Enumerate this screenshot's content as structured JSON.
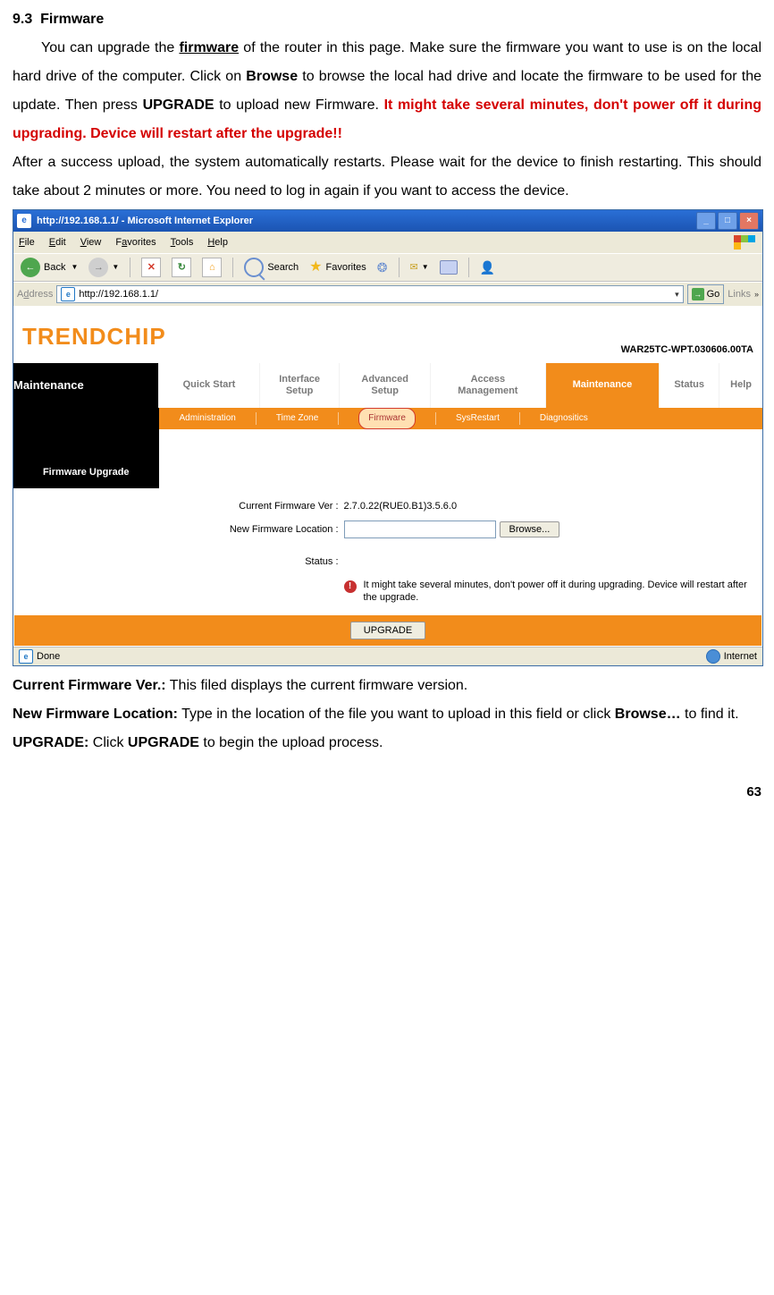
{
  "doc": {
    "section_number": "9.3",
    "section_title": "Firmware",
    "p1a": "You can upgrade the ",
    "p1_firmware": "firmware",
    "p1b": " of the router in this page. Make sure the firmware you want to use is on the local hard drive of the computer. Click on ",
    "p1_browse": "Browse",
    "p1c": " to browse the local had drive and locate the firmware to be used for the update. Then press ",
    "p1_upgrade": "UPGRADE",
    "p1d": " to upload new Firmware. ",
    "p1_red": "It might take several minutes, don't power off it during upgrading. Device will restart after the upgrade!!",
    "p2": "After a success upload, the system automatically restarts. Please wait for the device to finish restarting. This should take about 2 minutes or more. You need to log in again if you want to access the device.",
    "d1_label": "Current Firmware Ver.:",
    "d1_text": " This filed displays the current firmware version.",
    "d2_label": "New Firmware Location:",
    "d2_text_a": " Type in the location of the file you want to upload in this field or click ",
    "d2_browse": "Browse…",
    "d2_text_b": " to find it.",
    "d3_label": "UPGRADE:",
    "d3_text_a": " Click ",
    "d3_upgrade": "UPGRADE",
    "d3_text_b": " to begin the upload process.",
    "page_number": "63"
  },
  "ie": {
    "title": "http://192.168.1.1/ - Microsoft Internet Explorer",
    "menu": {
      "file": "File",
      "edit": "Edit",
      "view": "View",
      "favorites": "Favorites",
      "tools": "Tools",
      "help": "Help"
    },
    "toolbar": {
      "back": "Back",
      "search": "Search",
      "favorites": "Favorites"
    },
    "addr_label": "Address",
    "addr_value": "http://192.168.1.1/",
    "go": "Go",
    "links": "Links",
    "brand": "TRENDCHIP",
    "model": "WAR25TC-WPT.030606.00TA",
    "nav": {
      "main": "Maintenance",
      "quick": "Quick Start",
      "interface": "Interface Setup",
      "advanced": "Advanced Setup",
      "access": "Access Management",
      "maintenance": "Maintenance",
      "status": "Status",
      "help": "Help"
    },
    "subnav": {
      "admin": "Administration",
      "tz": "Time Zone",
      "fw": "Firmware",
      "restart": "SysRestart",
      "diag": "Diagnositics"
    },
    "section_label": "Firmware Upgrade",
    "form": {
      "cur_label": "Current Firmware Ver :",
      "cur_val": "2.7.0.22(RUE0.B1)3.5.6.0",
      "new_label": "New Firmware Location :",
      "browse": "Browse...",
      "status_label": "Status :",
      "status_text": "It might take several minutes, don't power off it during upgrading. Device will restart after the upgrade.",
      "upgrade": "UPGRADE"
    },
    "statusbar": {
      "done": "Done",
      "zone": "Internet"
    }
  }
}
